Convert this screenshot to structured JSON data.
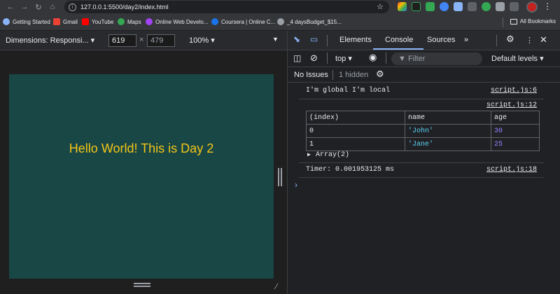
{
  "browser": {
    "url": "127.0.0.1:5500/day2/index.html",
    "bookmarks": [
      {
        "label": "Getting Started",
        "color": "#8ab4f8"
      },
      {
        "label": "Gmail",
        "color": "#ea4335"
      },
      {
        "label": "YouTube",
        "color": "#ff0000"
      },
      {
        "label": "Maps",
        "color": "#34a853"
      },
      {
        "label": "Online Web Develo...",
        "color": "#a142f4"
      },
      {
        "label": "Coursera | Online C...",
        "color": "#1a73e8"
      },
      {
        "label": "_4 daysBudget_$15...",
        "color": "#9aa0a6"
      }
    ],
    "all_bookmarks": "All Bookmarks"
  },
  "device_toolbar": {
    "dimensions_label": "Dimensions: Responsi...",
    "width": "619",
    "height": "479",
    "zoom": "100%"
  },
  "page": {
    "heading": "Hello World! This is Day 2",
    "heading_color": "#f5c518",
    "background": "#184745"
  },
  "devtools": {
    "tabs": [
      "Elements",
      "Console",
      "Sources"
    ],
    "active_tab": "Console",
    "context": "top",
    "filter_placeholder": "Filter",
    "levels": "Default levels",
    "no_issues": "No Issues",
    "hidden": "1 hidden",
    "logs": [
      {
        "text": "I'm global I'm local",
        "source": "script.js:6"
      },
      {
        "text": "",
        "source": "script.js:12"
      },
      {
        "text": "Timer: 0.001953125 ms",
        "source": "script.js:18"
      }
    ],
    "table": {
      "headers": [
        "(index)",
        "name",
        "age"
      ],
      "rows": [
        {
          "index": "0",
          "name": "'John'",
          "age": "30"
        },
        {
          "index": "1",
          "name": "'Jane'",
          "age": "25"
        }
      ]
    },
    "array_label": "Array(2)"
  }
}
